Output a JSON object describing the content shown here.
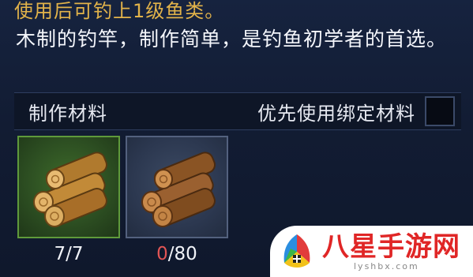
{
  "item": {
    "usage_hint": "使用后可钓上1级鱼类。",
    "description": "木制的钓竿，制作简单，是钓鱼初学者的首选。"
  },
  "materials": {
    "title": "制作材料",
    "priority_label": "优先使用绑定材料",
    "priority_checked": false,
    "slots": [
      {
        "icon": "wood-log-icon",
        "have": "7",
        "need": "7",
        "rarity_color": "#5f9a3b"
      },
      {
        "icon": "wood-log-icon",
        "have": "0",
        "need": "80",
        "rarity_color": "#53617e"
      }
    ],
    "separator": "/"
  },
  "colors": {
    "hint": "#e2b34a",
    "insufficient": "#e25555",
    "watermark_red": "#e02626"
  },
  "watermark": {
    "text": "八星手游网",
    "url": "lyshbx.com"
  }
}
